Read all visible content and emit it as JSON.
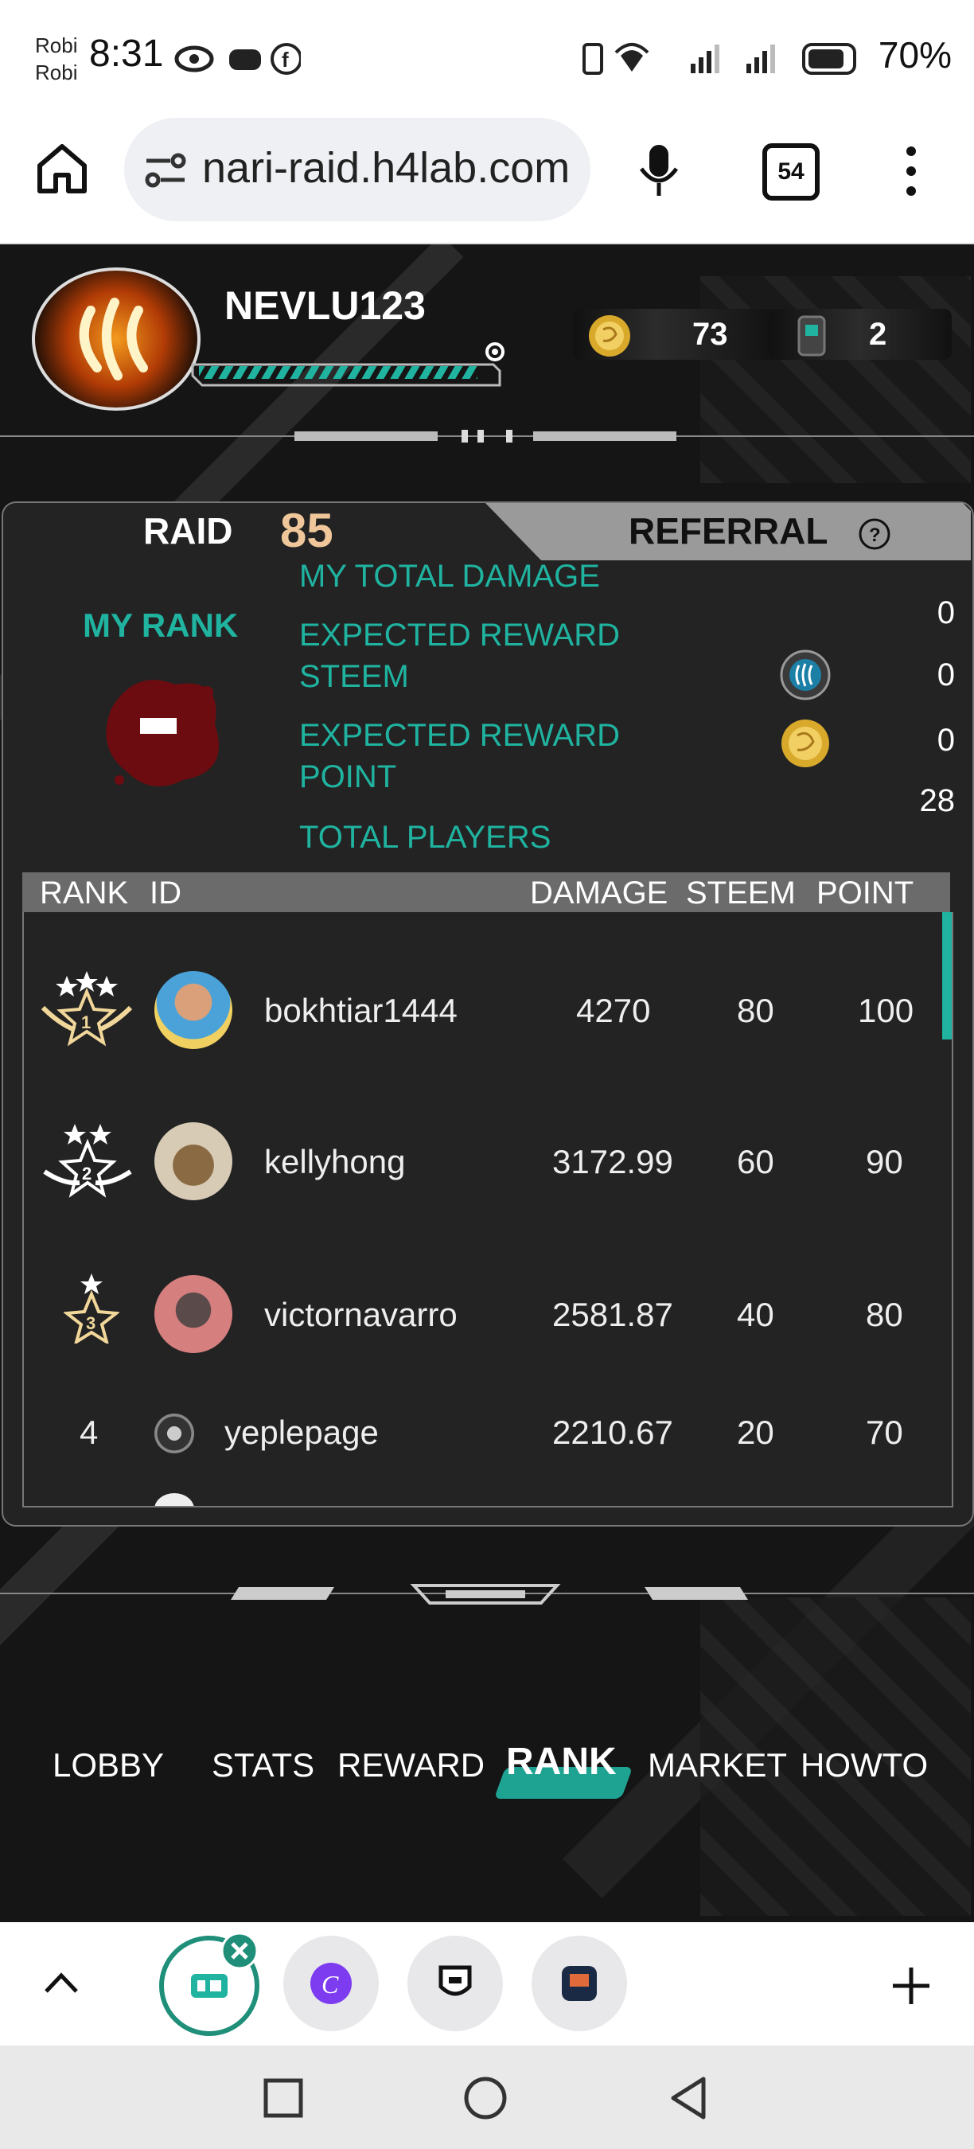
{
  "status": {
    "carrier_top": "Robi",
    "carrier_bottom": "Robi",
    "time": "8:31",
    "battery": "70%"
  },
  "browser": {
    "url": "nari-raid.h4lab.com",
    "tab_count": "54"
  },
  "player": {
    "name": "NEVLU123",
    "coins": "73",
    "tickets": "2"
  },
  "tabs": {
    "raid_label": "RAID",
    "raid_number": "85",
    "referral_label": "REFERRAL"
  },
  "summary": {
    "my_rank_label": "MY RANK",
    "total_damage_label": "MY TOTAL DAMAGE",
    "total_damage_value": "0",
    "reward_steem_label_1": "EXPECTED REWARD",
    "reward_steem_label_2": "STEEM",
    "reward_steem_value": "0",
    "reward_point_label_1": "EXPECTED REWARD",
    "reward_point_label_2": "POINT",
    "reward_point_value": "0",
    "total_players_label": "TOTAL PLAYERS",
    "total_players_value": "28"
  },
  "table": {
    "headers": {
      "rank": "RANK",
      "id": "ID",
      "damage": "DAMAGE",
      "steem": "STEEM",
      "point": "POINT"
    },
    "rows": [
      {
        "rank": "1",
        "id": "bokhtiar1444",
        "damage": "4270",
        "steem": "80",
        "point": "100"
      },
      {
        "rank": "2",
        "id": "kellyhong",
        "damage": "3172.99",
        "steem": "60",
        "point": "90"
      },
      {
        "rank": "3",
        "id": "victornavarro",
        "damage": "2581.87",
        "steem": "40",
        "point": "80"
      },
      {
        "rank": "4",
        "id": "yeplepage",
        "damage": "2210.67",
        "steem": "20",
        "point": "70"
      }
    ]
  },
  "nav": {
    "lobby": "LOBBY",
    "stats": "STATS",
    "reward": "REWARD",
    "rank": "RANK",
    "market": "MARKET",
    "howto": "HOWTO"
  },
  "colors": {
    "accent_teal": "#1fb3a0",
    "raid_number": "#f0c79a",
    "background": "#151515"
  }
}
